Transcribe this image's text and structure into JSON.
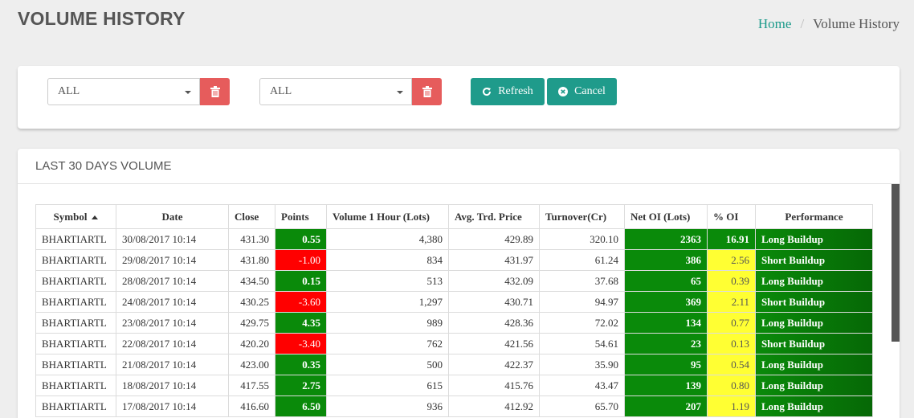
{
  "header": {
    "title": "VOLUME HISTORY",
    "breadcrumb": {
      "home": "Home",
      "separator": "/",
      "current": "Volume History"
    }
  },
  "filters": {
    "select1": {
      "value": "ALL"
    },
    "select2": {
      "value": "ALL"
    },
    "refresh_label": "Refresh",
    "cancel_label": "Cancel"
  },
  "table_card": {
    "title": "LAST 30 DAYS VOLUME",
    "columns": [
      "Symbol",
      "Date",
      "Close",
      "Points",
      "Volume 1 Hour (Lots)",
      "Avg. Trd. Price",
      "Turnover(Cr)",
      "Net OI (Lots)",
      "% OI",
      "Performance"
    ],
    "rows": [
      [
        "BHARTIARTL",
        "30/08/2017 10:14",
        "431.30",
        "0.55",
        "4,380",
        "429.89",
        "320.10",
        "2363",
        "16.91",
        "Long Buildup"
      ],
      [
        "BHARTIARTL",
        "29/08/2017 10:14",
        "431.80",
        "-1.00",
        "834",
        "431.97",
        "61.24",
        "386",
        "2.56",
        "Short Buildup"
      ],
      [
        "BHARTIARTL",
        "28/08/2017 10:14",
        "434.50",
        "0.15",
        "513",
        "432.09",
        "37.68",
        "65",
        "0.39",
        "Long Buildup"
      ],
      [
        "BHARTIARTL",
        "24/08/2017 10:14",
        "430.25",
        "-3.60",
        "1,297",
        "430.71",
        "94.97",
        "369",
        "2.11",
        "Short Buildup"
      ],
      [
        "BHARTIARTL",
        "23/08/2017 10:14",
        "429.75",
        "4.35",
        "989",
        "428.36",
        "72.02",
        "134",
        "0.77",
        "Long Buildup"
      ],
      [
        "BHARTIARTL",
        "22/08/2017 10:14",
        "420.20",
        "-3.40",
        "762",
        "421.56",
        "54.61",
        "23",
        "0.13",
        "Short Buildup"
      ],
      [
        "BHARTIARTL",
        "21/08/2017 10:14",
        "423.00",
        "0.35",
        "500",
        "422.37",
        "35.90",
        "95",
        "0.54",
        "Long Buildup"
      ],
      [
        "BHARTIARTL",
        "18/08/2017 10:14",
        "417.55",
        "2.75",
        "615",
        "415.76",
        "43.47",
        "139",
        "0.80",
        "Long Buildup"
      ],
      [
        "BHARTIARTL",
        "17/08/2017 10:14",
        "416.60",
        "6.50",
        "936",
        "412.92",
        "65.70",
        "207",
        "1.19",
        "Long Buildup"
      ]
    ]
  },
  "colors": {
    "accent": "#1f9b8b",
    "danger": "#e65c5c",
    "positive": "#0a8a0a",
    "negative": "#ff0000",
    "highlight": "#ffff33"
  }
}
